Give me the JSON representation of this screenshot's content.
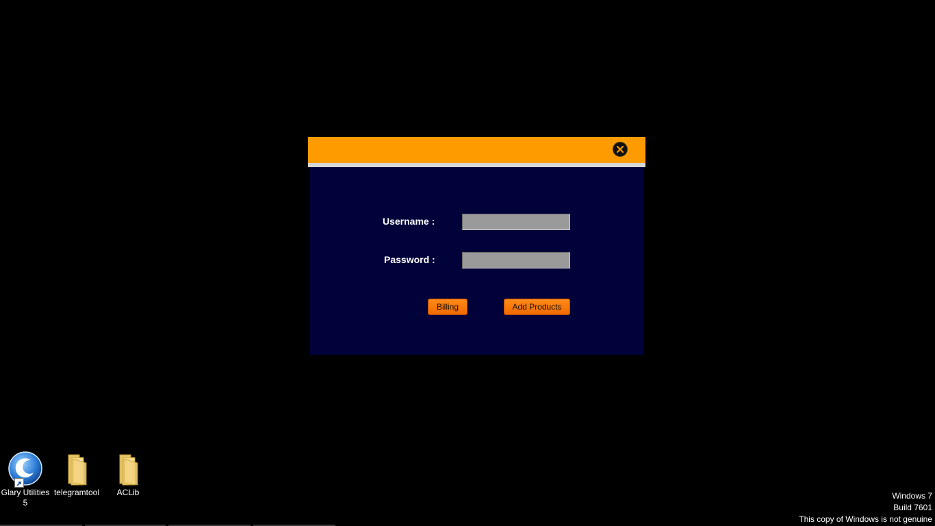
{
  "dialog": {
    "header_color": "#fe9b00",
    "body_color": "#02023a",
    "close_icon": "close-icon",
    "fields": {
      "username_label": "Username :",
      "username_value": "",
      "password_label": "Password :",
      "password_value": ""
    },
    "buttons": {
      "billing": "Billing",
      "add_products": "Add Products"
    }
  },
  "desktop": {
    "icons": [
      {
        "label": "Glary Utilities 5",
        "icon": "glary-utilities-icon"
      },
      {
        "label": "telegramtool",
        "icon": "folder-icon"
      },
      {
        "label": "ACLib",
        "icon": "folder-icon"
      }
    ]
  },
  "watermark": {
    "line1": "Windows 7",
    "line2": "Build 7601",
    "line3": "This copy of Windows is not genuine"
  }
}
